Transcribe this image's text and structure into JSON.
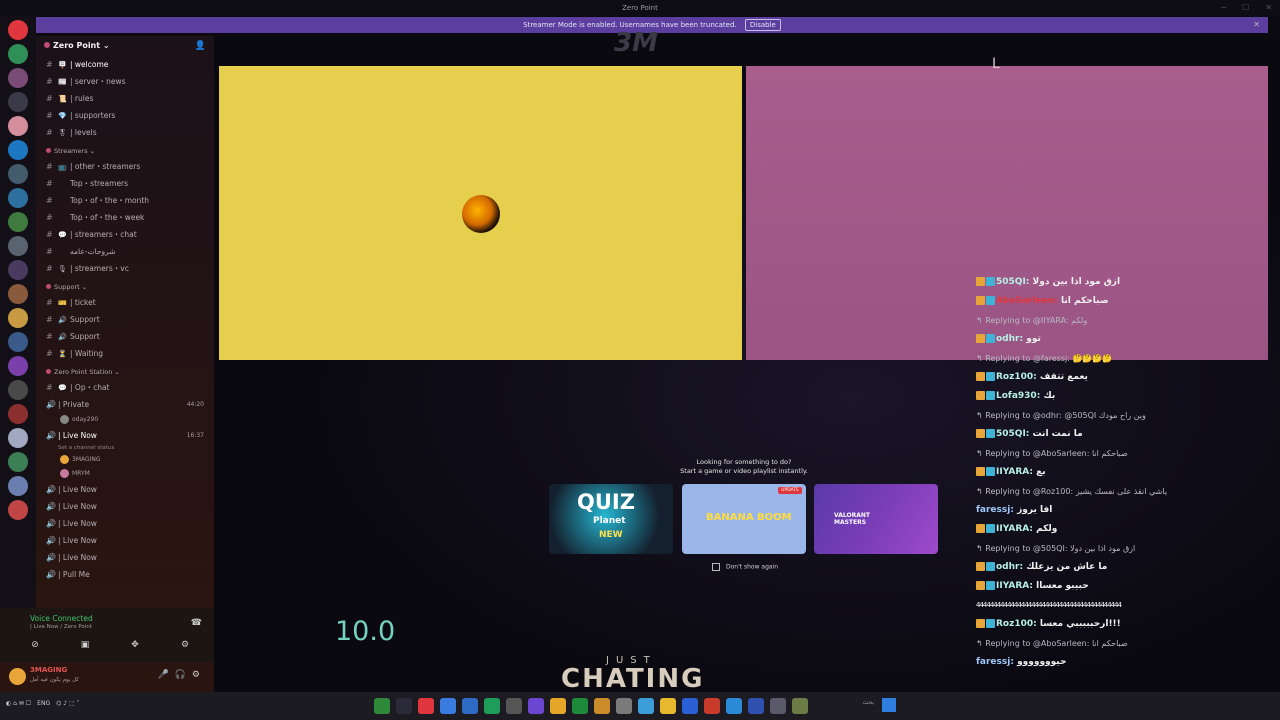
{
  "window": {
    "title": "Zero Point"
  },
  "banner": {
    "text": "Streamer Mode is enabled. Usernames have been truncated.",
    "disable": "Disable"
  },
  "server": {
    "name": "Zero Point"
  },
  "channels": [
    {
      "kind": "ch",
      "name": "| welcome",
      "emo": "🪧",
      "active": true
    },
    {
      "kind": "ch",
      "name": "| server・news",
      "emo": "📰"
    },
    {
      "kind": "ch",
      "name": "| rules",
      "emo": "📜"
    },
    {
      "kind": "ch",
      "name": "| supporters",
      "emo": "💎"
    },
    {
      "kind": "ch",
      "name": "| levels",
      "emo": "🎖"
    },
    {
      "kind": "cat",
      "name": "Streamers"
    },
    {
      "kind": "ch",
      "name": "| other・streamers",
      "emo": "📺"
    },
    {
      "kind": "ch",
      "name": "Top・streamers",
      "emo": ""
    },
    {
      "kind": "ch",
      "name": "Top・of・the・month",
      "emo": ""
    },
    {
      "kind": "ch",
      "name": "Top・of・the・week",
      "emo": ""
    },
    {
      "kind": "ch",
      "name": "| streamers・chat",
      "emo": "💬"
    },
    {
      "kind": "ch",
      "name": "شروحات-عامه",
      "emo": ""
    },
    {
      "kind": "ch",
      "name": "| streamers・vc",
      "emo": "🎙"
    },
    {
      "kind": "cat",
      "name": "Support"
    },
    {
      "kind": "ch",
      "name": "| ticket",
      "emo": "🎫"
    },
    {
      "kind": "ch",
      "name": "Support",
      "emo": "🔊"
    },
    {
      "kind": "ch",
      "name": "Support",
      "emo": "🔊"
    },
    {
      "kind": "ch",
      "name": "| Waiting",
      "emo": "⏳"
    },
    {
      "kind": "cat",
      "name": "Zero Point Station"
    },
    {
      "kind": "ch",
      "name": "| Op・chat",
      "emo": "💬"
    }
  ],
  "voice_channels": {
    "private": {
      "name": "| Private",
      "time": "44:20",
      "users": [
        {
          "name": "oday290"
        }
      ]
    },
    "live": {
      "name": "| Live Now",
      "time": "16:37",
      "status": "Set a channel status",
      "users": [
        {
          "name": "3MAGING"
        },
        {
          "name": "MRYM"
        }
      ]
    },
    "others": [
      "| Live Now",
      "| Live Now",
      "| Live Now",
      "| Live Now",
      "| Live Now",
      "| Pull Me"
    ]
  },
  "voice_panel": {
    "title": "Voice Connected",
    "sub": "| Live Now / Zero Point"
  },
  "user_panel": {
    "name": "3MAGING",
    "sub": "كل يوم يكون فيه أمل"
  },
  "stage": {
    "logo": "3M",
    "corner_mark": "L",
    "prompt_title": "Looking for something to do?",
    "prompt_sub": "Start a game or video playlist instantly.",
    "tiles": [
      {
        "title": "QUIZ",
        "sub": "Planet",
        "badge": "NEW"
      },
      {
        "title": "BANANA BOOM",
        "badge": "UPDATE"
      },
      {
        "title": "VALORANT MASTERS"
      }
    ],
    "dont_show": "Don't show again",
    "score": "10.0",
    "just": "JUST",
    "chating": "CHATING"
  },
  "chat": [
    {
      "type": "msg",
      "name": "505QI:",
      "text": "ازق مود اذا بين دولا"
    },
    {
      "type": "msg",
      "name": "AboSarleen:",
      "text": "صباحكم انا",
      "redname": true
    },
    {
      "type": "reply",
      "text": "Replying to @IIYARA: ولكم"
    },
    {
      "type": "msg",
      "name": "odhr:",
      "text": "توو"
    },
    {
      "type": "reply",
      "text": "Replying to @faressj: 🤔🤔🤔🤔"
    },
    {
      "type": "msg",
      "name": "Roz100:",
      "text": "يعمع تتقف"
    },
    {
      "type": "msg",
      "name": "Lofa930:",
      "text": "بك"
    },
    {
      "type": "reply",
      "text": "Replying to @odhr: @505QI وين راح مودك"
    },
    {
      "type": "msg",
      "name": "505QI:",
      "text": "ما نمت انت"
    },
    {
      "type": "reply",
      "text": "Replying to @AboSarleen: صباحكم انا"
    },
    {
      "type": "msg",
      "name": "IIYARA:",
      "text": "بع"
    },
    {
      "type": "reply",
      "text": "Replying to @Roz100: ياشي انقذ على نفسك يشيز"
    },
    {
      "type": "msg",
      "name": "faressj:",
      "text": "افا يروز",
      "noicon": true
    },
    {
      "type": "msg",
      "name": "IIYARA:",
      "text": "ولكم"
    },
    {
      "type": "reply",
      "text": "Replying to @505QI: ازق مود اذا بين دولا"
    },
    {
      "type": "msg",
      "name": "odhr:",
      "text": "ما عاش من يزعلك"
    },
    {
      "type": "msg",
      "name": "IIYARA:",
      "text": "حبيبو معساا"
    },
    {
      "type": "divider",
      "text": "444444444444444444444444444444444444444444"
    },
    {
      "type": "msg",
      "name": "Roz100:",
      "text": "ارحبببببي معسا!!!"
    },
    {
      "type": "reply",
      "text": "Replying to @AboSarleen: صباحكم انا"
    },
    {
      "type": "msg",
      "name": "faressj:",
      "text": "حيووووووو",
      "noicon": true
    }
  ],
  "taskbar": {
    "lang": "ENG",
    "search": "بحث"
  }
}
